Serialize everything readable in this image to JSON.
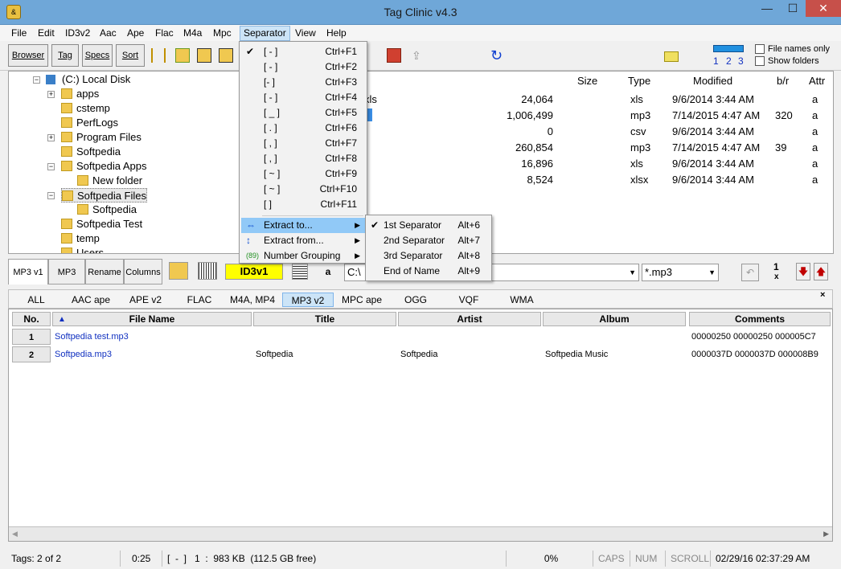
{
  "window": {
    "title": "Tag Clinic v4.3",
    "icon_text": "&"
  },
  "menubar": [
    "File",
    "Edit",
    "ID3v2",
    "Aac",
    "Ape",
    "Flac",
    "M4a",
    "Mpc",
    "Separator",
    "View",
    "Help"
  ],
  "toolbar": {
    "buttons": [
      "Browser",
      "Tag",
      "Specs",
      "Sort"
    ],
    "view_numbers": [
      "1",
      "2",
      "3"
    ],
    "checkboxes": [
      "File names only",
      "Show folders"
    ]
  },
  "tree": [
    {
      "label": "(C:)  Local Disk"
    },
    {
      "label": "apps"
    },
    {
      "label": "cstemp"
    },
    {
      "label": "PerfLogs"
    },
    {
      "label": "Program Files"
    },
    {
      "label": "Softpedia"
    },
    {
      "label": "Softpedia Apps"
    },
    {
      "label": "New folder"
    },
    {
      "label": "Softpedia Files"
    },
    {
      "label": "Softpedia"
    },
    {
      "label": "Softpedia Test"
    },
    {
      "label": "temp"
    },
    {
      "label": "Users"
    }
  ],
  "filelist": {
    "headers": [
      "Size",
      "Type",
      "Modified",
      "b/r",
      "Attr"
    ],
    "rows": [
      {
        "name": "xls",
        "size": "24,064",
        "type": "xls",
        "modified": "9/6/2014 3:44 AM",
        "br": "",
        "attr": "a"
      },
      {
        "name": "",
        "size": "1,006,499",
        "type": "mp3",
        "modified": "7/14/2015 4:47 AM",
        "br": "320",
        "attr": "a"
      },
      {
        "name": "",
        "size": "0",
        "type": "csv",
        "modified": "9/6/2014 3:44 AM",
        "br": "",
        "attr": "a"
      },
      {
        "name": "",
        "size": "260,854",
        "type": "mp3",
        "modified": "7/14/2015 4:47 AM",
        "br": "39",
        "attr": "a"
      },
      {
        "name": "",
        "size": "16,896",
        "type": "xls",
        "modified": "9/6/2014 3:44 AM",
        "br": "",
        "attr": "a"
      },
      {
        "name": "",
        "size": "8,524",
        "type": "xlsx",
        "modified": "9/6/2014 3:44 AM",
        "br": "",
        "attr": "a"
      }
    ]
  },
  "separator_menu": {
    "items": [
      {
        "label": "[ - ]",
        "shortcut": "Ctrl+F1",
        "checked": "✔"
      },
      {
        "label": "[ - ]",
        "shortcut": "Ctrl+F2",
        "checked": ""
      },
      {
        "label": "[- ]",
        "shortcut": "Ctrl+F3",
        "checked": ""
      },
      {
        "label": "[ - ]",
        "shortcut": "Ctrl+F4",
        "checked": ""
      },
      {
        "label": "[ _ ]",
        "shortcut": "Ctrl+F5",
        "checked": ""
      },
      {
        "label": "[ . ]",
        "shortcut": "Ctrl+F6",
        "checked": ""
      },
      {
        "label": "[ , ]",
        "shortcut": "Ctrl+F7",
        "checked": ""
      },
      {
        "label": "[ , ]",
        "shortcut": "Ctrl+F8",
        "checked": ""
      },
      {
        "label": "[ ~ ]",
        "shortcut": "Ctrl+F9",
        "checked": ""
      },
      {
        "label": "[ ~ ]",
        "shortcut": "Ctrl+F10",
        "checked": ""
      },
      {
        "label": "[  ]",
        "shortcut": "Ctrl+F11",
        "checked": ""
      }
    ],
    "actions": [
      "Extract to...",
      "Extract from...",
      "Number Grouping"
    ]
  },
  "extract_submenu": [
    {
      "label": "1st Separator",
      "shortcut": "Alt+6",
      "checked": "✔"
    },
    {
      "label": "2nd Separator",
      "shortcut": "Alt+7",
      "checked": ""
    },
    {
      "label": "3rd Separator",
      "shortcut": "Alt+8",
      "checked": ""
    },
    {
      "label": "End of Name",
      "shortcut": "Alt+9",
      "checked": ""
    }
  ],
  "panel": {
    "tabs": [
      "MP3 v1",
      "MP3",
      "Rename",
      "Columns"
    ],
    "id3_label": "ID3v1",
    "a_label": "a",
    "path_value": "C:\\",
    "filter_value": "*.mp3",
    "counter": "1",
    "counter_x": "x"
  },
  "tag_tabs": [
    "ALL",
    "AAC ape",
    "APE v2",
    "FLAC",
    "M4A, MP4",
    "MP3 v2",
    "MPC ape",
    "OGG",
    "VQF",
    "WMA"
  ],
  "grid": {
    "headers": [
      "No.",
      "File Name",
      "Title",
      "Artist",
      "Album",
      "Comments"
    ],
    "rows": [
      {
        "no": "1",
        "file": "Softpedia test.mp3",
        "title": "",
        "artist": "",
        "album": "",
        "comments": "00000250 00000250 000005C7"
      },
      {
        "no": "2",
        "file": "Softpedia.mp3",
        "title": "Softpedia",
        "artist": "Softpedia",
        "album": "Softpedia Music",
        "comments": "0000037D 0000037D 000008B9"
      }
    ]
  },
  "status": {
    "tags": "Tags: 2 of 2",
    "time": "0:25",
    "info": "[  -  ]   1  :  983 KB  (112.5 GB free)",
    "percent": "0%",
    "caps": "CAPS",
    "num": "NUM",
    "scroll": "SCROLL",
    "datetime": "02/29/16 02:37:29 AM"
  }
}
